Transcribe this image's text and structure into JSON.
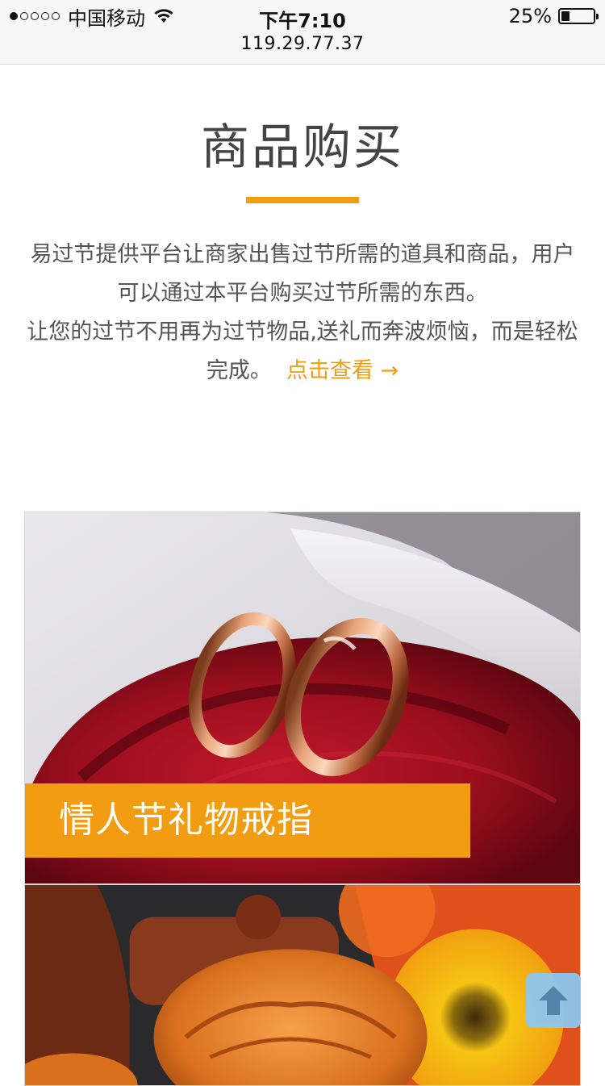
{
  "status_bar": {
    "carrier": "中国移动",
    "time": "下午7:10",
    "url": "119.29.77.37",
    "battery_percent": "25%",
    "battery_level": 0.25,
    "signal_bars_filled": 1,
    "signal_bars_total": 5
  },
  "section": {
    "title": "商品购买",
    "description_line1": "易过节提供平台让商家出售过节所需的道具和商品，用户可以通过本平台购买过节所需的东西。",
    "description_line2": "让您的过节不用再为过节物品,送礼而奔波烦恼，而是轻松完成。",
    "link_label": "点击查看 →",
    "accent_color": "#f29c12"
  },
  "cards": [
    {
      "caption": "情人节礼物戒指",
      "image": "rings-in-red-box"
    },
    {
      "caption": "",
      "image": "mooncakes-and-flowers"
    }
  ],
  "back_to_top": {
    "icon": "arrow-up-icon"
  }
}
